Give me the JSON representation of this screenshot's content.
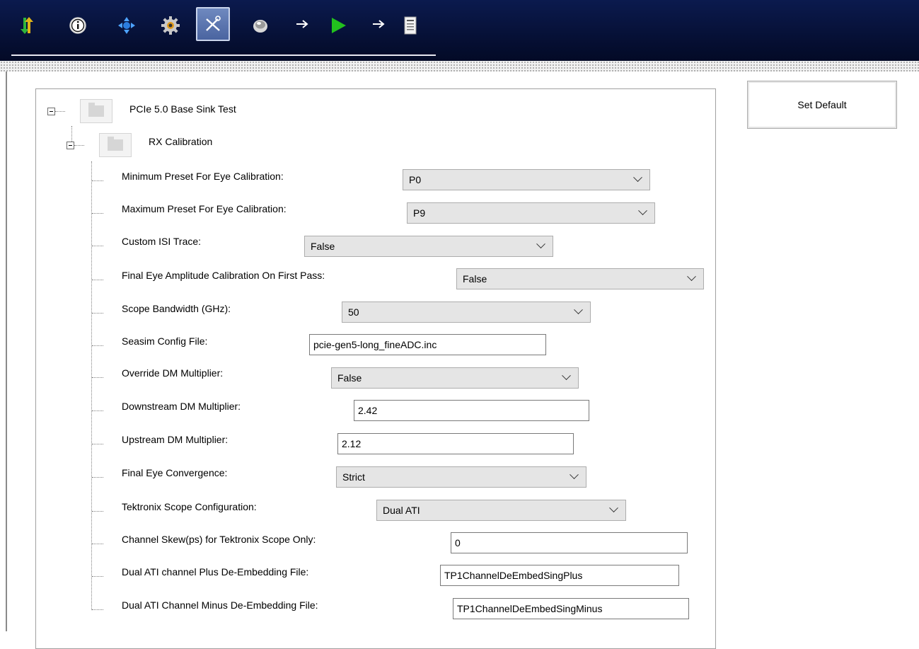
{
  "toolbar": {
    "icons": [
      "transfer-arrows-icon",
      "info-icon",
      "connect-icon",
      "gear-icon",
      "tools-icon",
      "record-icon",
      "arrow-icon",
      "run-icon",
      "arrow-icon",
      "report-icon"
    ],
    "colors": {
      "background": "#030a26",
      "active": "#5a74ad",
      "run": "#22c01e",
      "transfer": "#e0b417"
    }
  },
  "actions": {
    "set_default": "Set Default"
  },
  "tree": {
    "root_label": "PCIe 5.0 Base Sink Test",
    "child_label": "RX Calibration"
  },
  "params": [
    {
      "label": "Minimum Preset For Eye Calibration:",
      "value": "P0",
      "type": "select"
    },
    {
      "label": "Maximum Preset For Eye Calibration:",
      "value": "P9",
      "type": "select"
    },
    {
      "label": "Custom ISI Trace:",
      "value": "False",
      "type": "select"
    },
    {
      "label": "Final Eye Amplitude Calibration On First Pass:",
      "value": "False",
      "type": "select"
    },
    {
      "label": "Scope Bandwidth (GHz):",
      "value": "50",
      "type": "select"
    },
    {
      "label": "Seasim Config File:",
      "value": "pcie-gen5-long_fineADC.inc",
      "type": "text"
    },
    {
      "label": "Override DM Multiplier:",
      "value": "False",
      "type": "select"
    },
    {
      "label": "Downstream DM Multiplier:",
      "value": "2.42",
      "type": "text"
    },
    {
      "label": "Upstream DM Multiplier:",
      "value": "2.12",
      "type": "text"
    },
    {
      "label": "Final Eye Convergence:",
      "value": "Strict",
      "type": "select"
    },
    {
      "label": "Tektronix Scope Configuration:",
      "value": "Dual ATI",
      "type": "select"
    },
    {
      "label": "Channel Skew(ps) for Tektronix Scope Only:",
      "value": "0",
      "type": "text"
    },
    {
      "label": "Dual ATI channel Plus De-Embedding File:",
      "value": "TP1ChannelDeEmbedSingPlus",
      "type": "text"
    },
    {
      "label": "Dual ATI Channel Minus De-Embedding File:",
      "value": "TP1ChannelDeEmbedSingMinus",
      "type": "text"
    }
  ]
}
